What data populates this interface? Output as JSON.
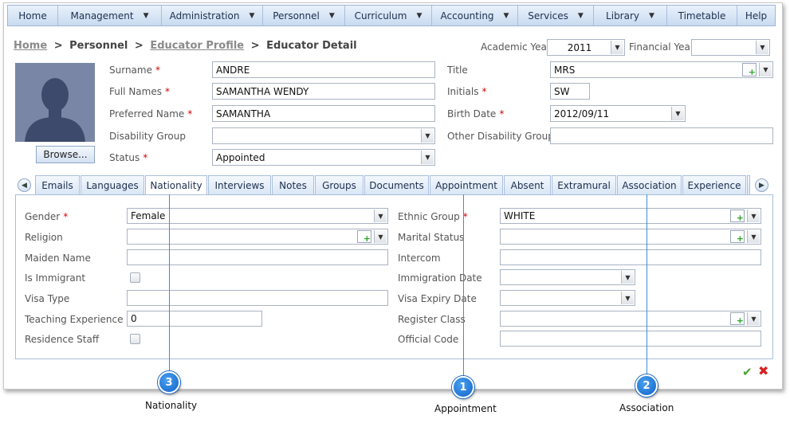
{
  "menu": [
    {
      "label": "Home",
      "dropdown": false
    },
    {
      "label": "Management",
      "dropdown": true
    },
    {
      "label": "Administration",
      "dropdown": true
    },
    {
      "label": "Personnel",
      "dropdown": true
    },
    {
      "label": "Curriculum",
      "dropdown": true
    },
    {
      "label": "Accounting",
      "dropdown": true
    },
    {
      "label": "Services",
      "dropdown": true
    },
    {
      "label": "Library",
      "dropdown": true
    },
    {
      "label": "Timetable",
      "dropdown": false
    },
    {
      "label": "Help",
      "dropdown": false
    }
  ],
  "breadcrumb": {
    "home": "Home",
    "personnel": "Personnel",
    "educator_profile": "Educator Profile",
    "current": "Educator Detail",
    "separator": ">"
  },
  "year": {
    "academic_label": "Academic Year",
    "academic_value": "2011",
    "financial_label": "Financial Year",
    "financial_value": ""
  },
  "profile": {
    "browse_label": "Browse...",
    "surname": {
      "label": "Surname",
      "value": "ANDRE",
      "required": "*"
    },
    "full_names": {
      "label": "Full Names",
      "value": "SAMANTHA WENDY",
      "required": "*"
    },
    "preferred_name": {
      "label": "Preferred Name",
      "value": "SAMANTHA",
      "required": "*"
    },
    "disability_group": {
      "label": "Disability Group",
      "value": ""
    },
    "status": {
      "label": "Status",
      "value": "Appointed",
      "required": "*"
    },
    "title": {
      "label": "Title",
      "value": "MRS"
    },
    "initials": {
      "label": "Initials",
      "value": "SW",
      "required": "*"
    },
    "birth_date": {
      "label": "Birth Date",
      "value": "2012/09/11",
      "required": "*"
    },
    "other_disability_group": {
      "label": "Other Disability Group",
      "value": ""
    }
  },
  "tabs": [
    "Emails",
    "Languages",
    "Nationality",
    "Interviews",
    "Notes",
    "Groups",
    "Documents",
    "Appointment",
    "Absent",
    "Extramural",
    "Association",
    "Experience"
  ],
  "active_tab": "Nationality",
  "nationality": {
    "gender": {
      "label": "Gender",
      "value": "Female",
      "required": "*"
    },
    "religion": {
      "label": "Religion",
      "value": ""
    },
    "maiden_name": {
      "label": "Maiden Name",
      "value": ""
    },
    "is_immigrant": {
      "label": "Is Immigrant",
      "checked": false
    },
    "visa_type": {
      "label": "Visa Type",
      "value": ""
    },
    "teaching_experience": {
      "label": "Teaching Experience",
      "value": "0"
    },
    "residence_staff": {
      "label": "Residence Staff",
      "checked": false
    },
    "ethnic_group": {
      "label": "Ethnic Group",
      "value": "WHITE",
      "required": "*"
    },
    "marital_status": {
      "label": "Marital Status",
      "value": ""
    },
    "intercom": {
      "label": "Intercom",
      "value": ""
    },
    "immigration_date": {
      "label": "Immigration Date",
      "value": ""
    },
    "visa_expiry_date": {
      "label": "Visa Expiry Date",
      "value": ""
    },
    "register_class": {
      "label": "Register Class",
      "value": ""
    },
    "official_code": {
      "label": "Official Code",
      "value": ""
    }
  },
  "callouts": [
    {
      "number": "3",
      "caption": "Nationality"
    },
    {
      "number": "1",
      "caption": "Appointment"
    },
    {
      "number": "2",
      "caption": "Association"
    }
  ],
  "colors": {
    "accent": "#1063c8",
    "required": "#d40000",
    "ok": "#4aa52d",
    "cancel": "#d62020"
  }
}
